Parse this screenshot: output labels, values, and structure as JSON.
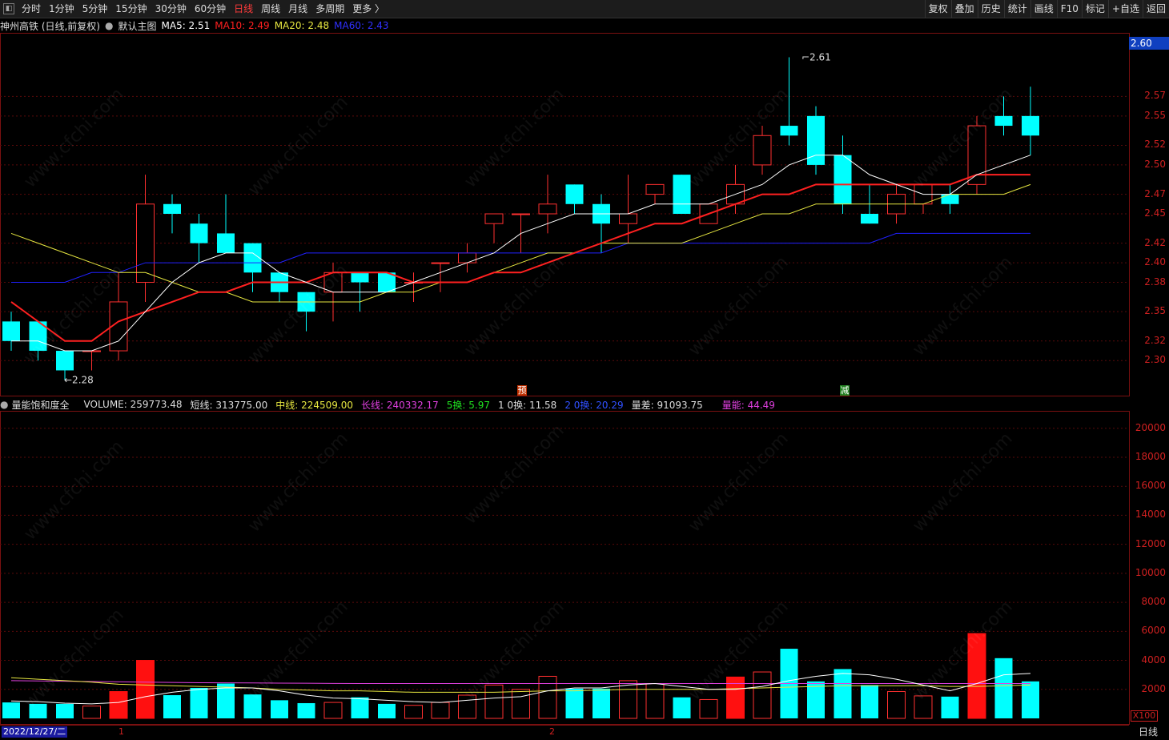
{
  "toolbar": {
    "left": [
      "分时",
      "1分钟",
      "5分钟",
      "15分钟",
      "30分钟",
      "60分钟",
      "日线",
      "周线",
      "月线",
      "多周期",
      "更多 〉"
    ],
    "active": "日线",
    "right": [
      "复权",
      "叠加",
      "历史",
      "统计",
      "画线",
      "F10",
      "标记",
      "+自选",
      "返回"
    ]
  },
  "legend": {
    "stock": "神州高铁 (日线,前复权)",
    "template": "默认主图",
    "ma5": "MA5: 2.51",
    "ma10": "MA10: 2.49",
    "ma20": "MA20: 2.48",
    "ma60": "MA60: 2.43"
  },
  "colors": {
    "up": "#ff3030",
    "down": "#00ffff",
    "ma5": "#ffffff",
    "ma10": "#ff2020",
    "ma20": "#e6e640",
    "ma60": "#2020ff"
  },
  "price_axis": [
    "2.57",
    "2.55",
    "2.52",
    "2.50",
    "2.47",
    "2.45",
    "2.42",
    "2.40",
    "2.38",
    "2.35",
    "2.32",
    "2.30"
  ],
  "current_price": "2.60",
  "high_label": "2.61",
  "low_label": "2.28",
  "markers": {
    "pre": "预",
    "cut": "减"
  },
  "vol_legend": {
    "name": "量能饱和度全",
    "volume": "VOLUME: 259773.48",
    "short": "短线: 313775.00",
    "mid": "中线: 224509.00",
    "long": "长线: 240332.17",
    "h5": "5换: 5.97",
    "h10": "1 0换: 11.58",
    "h20": "2 0换: 20.29",
    "diff": "量差: 91093.75",
    "energy": "量能: 44.49"
  },
  "vol_axis": [
    "20000",
    "18000",
    "16000",
    "14000",
    "12000",
    "10000",
    "8000",
    "6000",
    "4000",
    "2000"
  ],
  "vol_unit": "X100",
  "date": "2022/12/27/二",
  "period_marks": [
    "1",
    "2"
  ],
  "period_label": "日线",
  "watermark": "www.cfchi.com",
  "chart_data": {
    "type": "candlestick",
    "candles": [
      {
        "o": 2.34,
        "h": 2.35,
        "l": 2.31,
        "c": 2.32
      },
      {
        "o": 2.34,
        "h": 2.34,
        "l": 2.3,
        "c": 2.31
      },
      {
        "o": 2.31,
        "h": 2.31,
        "l": 2.28,
        "c": 2.29
      },
      {
        "o": 2.31,
        "h": 2.31,
        "l": 2.29,
        "c": 2.31
      },
      {
        "o": 2.31,
        "h": 2.39,
        "l": 2.3,
        "c": 2.36
      },
      {
        "o": 2.38,
        "h": 2.49,
        "l": 2.36,
        "c": 2.46
      },
      {
        "o": 2.46,
        "h": 2.47,
        "l": 2.43,
        "c": 2.45
      },
      {
        "o": 2.44,
        "h": 2.45,
        "l": 2.4,
        "c": 2.42
      },
      {
        "o": 2.43,
        "h": 2.47,
        "l": 2.41,
        "c": 2.41
      },
      {
        "o": 2.42,
        "h": 2.42,
        "l": 2.37,
        "c": 2.39
      },
      {
        "o": 2.39,
        "h": 2.39,
        "l": 2.36,
        "c": 2.37
      },
      {
        "o": 2.37,
        "h": 2.37,
        "l": 2.33,
        "c": 2.35
      },
      {
        "o": 2.37,
        "h": 2.4,
        "l": 2.34,
        "c": 2.39
      },
      {
        "o": 2.39,
        "h": 2.39,
        "l": 2.35,
        "c": 2.38
      },
      {
        "o": 2.39,
        "h": 2.39,
        "l": 2.37,
        "c": 2.37
      },
      {
        "o": 2.38,
        "h": 2.39,
        "l": 2.36,
        "c": 2.38
      },
      {
        "o": 2.4,
        "h": 2.4,
        "l": 2.37,
        "c": 2.4
      },
      {
        "o": 2.4,
        "h": 2.42,
        "l": 2.39,
        "c": 2.41
      },
      {
        "o": 2.44,
        "h": 2.45,
        "l": 2.42,
        "c": 2.45
      },
      {
        "o": 2.45,
        "h": 2.45,
        "l": 2.41,
        "c": 2.45
      },
      {
        "o": 2.45,
        "h": 2.49,
        "l": 2.43,
        "c": 2.46
      },
      {
        "o": 2.48,
        "h": 2.48,
        "l": 2.45,
        "c": 2.46
      },
      {
        "o": 2.46,
        "h": 2.47,
        "l": 2.41,
        "c": 2.44
      },
      {
        "o": 2.44,
        "h": 2.49,
        "l": 2.42,
        "c": 2.45
      },
      {
        "o": 2.47,
        "h": 2.48,
        "l": 2.46,
        "c": 2.48
      },
      {
        "o": 2.49,
        "h": 2.49,
        "l": 2.45,
        "c": 2.45
      },
      {
        "o": 2.44,
        "h": 2.46,
        "l": 2.44,
        "c": 2.46
      },
      {
        "o": 2.46,
        "h": 2.5,
        "l": 2.45,
        "c": 2.48
      },
      {
        "o": 2.5,
        "h": 2.54,
        "l": 2.49,
        "c": 2.53
      },
      {
        "o": 2.54,
        "h": 2.61,
        "l": 2.52,
        "c": 2.53
      },
      {
        "o": 2.55,
        "h": 2.56,
        "l": 2.49,
        "c": 2.5
      },
      {
        "o": 2.51,
        "h": 2.53,
        "l": 2.45,
        "c": 2.46
      },
      {
        "o": 2.45,
        "h": 2.48,
        "l": 2.44,
        "c": 2.44
      },
      {
        "o": 2.45,
        "h": 2.48,
        "l": 2.44,
        "c": 2.47
      },
      {
        "o": 2.46,
        "h": 2.48,
        "l": 2.45,
        "c": 2.48
      },
      {
        "o": 2.47,
        "h": 2.48,
        "l": 2.45,
        "c": 2.46
      },
      {
        "o": 2.48,
        "h": 2.55,
        "l": 2.47,
        "c": 2.54
      },
      {
        "o": 2.55,
        "h": 2.57,
        "l": 2.53,
        "c": 2.54
      },
      {
        "o": 2.55,
        "h": 2.58,
        "l": 2.51,
        "c": 2.53
      }
    ],
    "ma5": [
      2.32,
      2.32,
      2.31,
      2.31,
      2.32,
      2.35,
      2.38,
      2.4,
      2.41,
      2.41,
      2.39,
      2.38,
      2.37,
      2.37,
      2.37,
      2.38,
      2.39,
      2.4,
      2.41,
      2.43,
      2.44,
      2.45,
      2.45,
      2.45,
      2.46,
      2.46,
      2.46,
      2.47,
      2.48,
      2.5,
      2.51,
      2.51,
      2.49,
      2.48,
      2.47,
      2.47,
      2.49,
      2.5,
      2.51
    ],
    "ma10": [
      2.36,
      2.34,
      2.32,
      2.32,
      2.34,
      2.35,
      2.36,
      2.37,
      2.37,
      2.38,
      2.38,
      2.38,
      2.39,
      2.39,
      2.39,
      2.38,
      2.38,
      2.38,
      2.39,
      2.39,
      2.4,
      2.41,
      2.42,
      2.43,
      2.44,
      2.44,
      2.45,
      2.46,
      2.47,
      2.47,
      2.48,
      2.48,
      2.48,
      2.48,
      2.48,
      2.48,
      2.49,
      2.49,
      2.49
    ],
    "ma20": [
      2.43,
      2.42,
      2.41,
      2.4,
      2.39,
      2.39,
      2.38,
      2.37,
      2.37,
      2.36,
      2.36,
      2.36,
      2.36,
      2.36,
      2.37,
      2.37,
      2.38,
      2.38,
      2.39,
      2.4,
      2.41,
      2.41,
      2.42,
      2.42,
      2.42,
      2.42,
      2.43,
      2.44,
      2.45,
      2.45,
      2.46,
      2.46,
      2.46,
      2.46,
      2.46,
      2.47,
      2.47,
      2.47,
      2.48
    ],
    "ma60": [
      2.38,
      2.38,
      2.38,
      2.39,
      2.39,
      2.4,
      2.4,
      2.4,
      2.4,
      2.4,
      2.4,
      2.41,
      2.41,
      2.41,
      2.41,
      2.41,
      2.41,
      2.41,
      2.41,
      2.41,
      2.41,
      2.41,
      2.41,
      2.42,
      2.42,
      2.42,
      2.42,
      2.42,
      2.42,
      2.42,
      2.42,
      2.42,
      2.42,
      2.43,
      2.43,
      2.43,
      2.43,
      2.43,
      2.43
    ],
    "volumes": [
      1100,
      1000,
      1000,
      850,
      1850,
      4000,
      1600,
      2100,
      2400,
      1650,
      1250,
      1050,
      1100,
      1450,
      1000,
      900,
      1100,
      1600,
      2300,
      2000,
      2900,
      2050,
      2050,
      2600,
      2400,
      1450,
      1300,
      2850,
      3200,
      4800,
      2550,
      3400,
      2300,
      1850,
      1550,
      1500,
      5850,
      4150,
      2550
    ],
    "vol_ma_short": [
      1200,
      1150,
      1050,
      1000,
      1100,
      1500,
      1800,
      2000,
      2100,
      2100,
      1900,
      1600,
      1400,
      1350,
      1250,
      1150,
      1100,
      1250,
      1400,
      1500,
      1900,
      2100,
      2100,
      2300,
      2400,
      2200,
      2000,
      2000,
      2200,
      2600,
      2900,
      3100,
      3000,
      2700,
      2300,
      1900,
      2400,
      3000,
      3100
    ],
    "vol_ma_mid": [
      2800,
      2700,
      2600,
      2500,
      2350,
      2300,
      2250,
      2200,
      2150,
      2100,
      2000,
      1950,
      1900,
      1900,
      1850,
      1800,
      1800,
      1800,
      1800,
      1850,
      1900,
      1900,
      1950,
      2000,
      2000,
      2000,
      2000,
      2050,
      2100,
      2150,
      2200,
      2250,
      2250,
      2250,
      2250,
      2200,
      2200,
      2250,
      2300
    ],
    "vol_ma_long": [
      2600,
      2580,
      2560,
      2540,
      2520,
      2500,
      2480,
      2460,
      2450,
      2440,
      2430,
      2420,
      2410,
      2400,
      2400,
      2400,
      2400,
      2400,
      2400,
      2400,
      2400,
      2400,
      2400,
      2400,
      2400,
      2400,
      2400,
      2400,
      2400,
      2400,
      2400,
      2400,
      2400,
      2400,
      2400,
      2400,
      2400,
      2400,
      2400
    ]
  }
}
